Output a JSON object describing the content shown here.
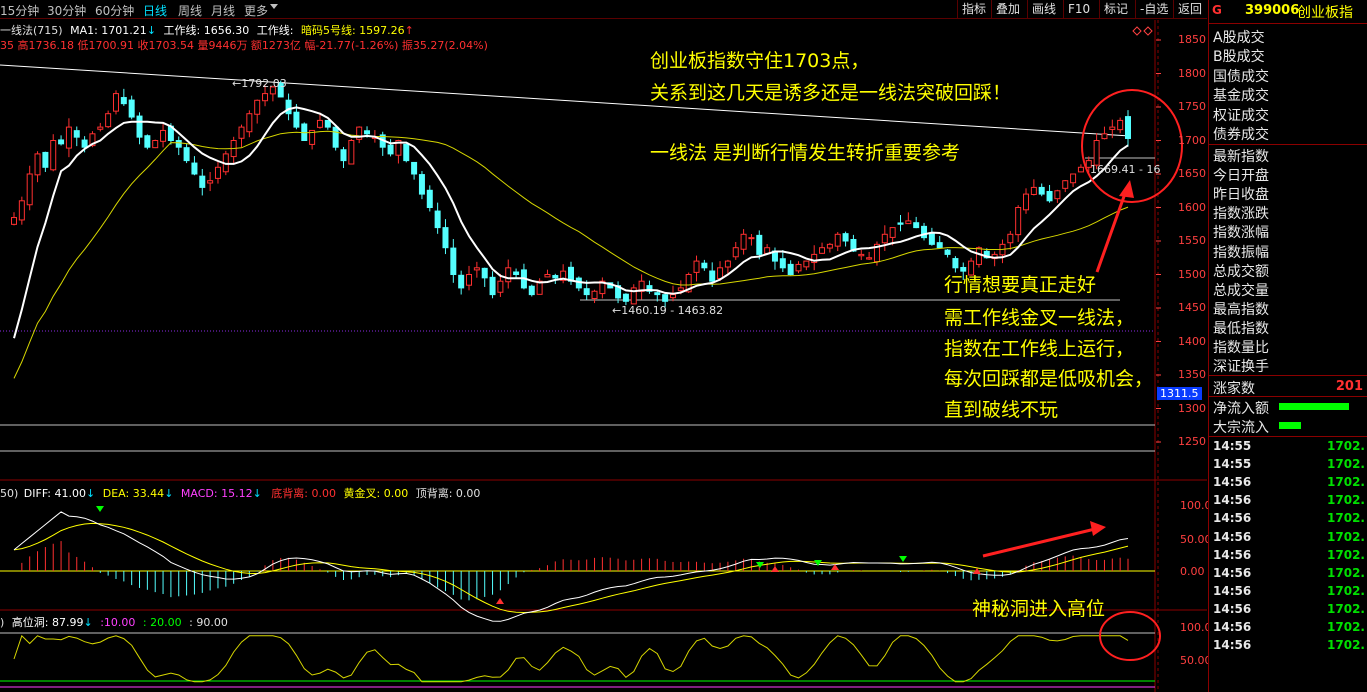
{
  "toolbar": {
    "periods": [
      "15分钟",
      "30分钟",
      "60分钟",
      "日线",
      "周线",
      "月线",
      "更多"
    ],
    "active_period": "日线",
    "buttons": [
      "指标",
      "叠加",
      "画线",
      "F10",
      "标记",
      "-自选",
      "返回"
    ]
  },
  "main_header": {
    "indicator": "一线法(715)",
    "ma1_label": "MA1: 1701.21",
    "work1_label": "工作线: 1656.30",
    "work2_label": "工作线:",
    "code5_label": "暗码5号线: 1597.26",
    "ohlc_text": "35 高1736.18 低1700.91 收1703.54 量9446万 额1273亿 幅-21.77(-1.26%) 振35.27(2.04%)"
  },
  "price_axis": [
    "1850",
    "1800",
    "1750",
    "1700",
    "1650",
    "1600",
    "1550",
    "1500",
    "1450",
    "1400",
    "1350",
    "1300",
    "1250"
  ],
  "current_price_tag": "1311.5",
  "chart_labels": {
    "high_mark": "1792.03",
    "low_mark": "1460.19 - 1463.82",
    "right_mark": "1669.41 - 16"
  },
  "macd_header": {
    "prefix": "50)",
    "diff": "DIFF: 41.00",
    "dea": "DEA: 33.44",
    "macd": "MACD: 15.12",
    "bottom_div": "底背离: 0.00",
    "golden": "黄金叉: 0.00",
    "top_div": "顶背离: 0.00"
  },
  "macd_axis": [
    "100.0",
    "50.00",
    "0.00"
  ],
  "osc_header": {
    "name": "高位洞: 87.99",
    "v1": ":10.00",
    "v2": ": 20.00",
    "v3": ": 90.00"
  },
  "osc_axis": [
    "100.0",
    "50.00"
  ],
  "annotations": {
    "a1": "创业板指数守住1703点，",
    "a2": "关系到这几天是诱多还是一线法突破回踩！",
    "a3": "一线法  是判断行情发生转折重要参考",
    "a4": "行情想要真正走好",
    "a5": "需工作线金叉一线法，",
    "a6": "指数在工作线上运行，",
    "a7": "每次回踩都是低吸机会，",
    "a8": "直到破线不玩",
    "a9": "神秘洞进入高位"
  },
  "right_panel": {
    "marker": "G",
    "code": "399006",
    "name": "创业板指",
    "volume_items": [
      "A股成交",
      "B股成交",
      "国债成交",
      "基金成交",
      "权证成交",
      "债券成交"
    ],
    "stat_items": [
      "最新指数",
      "今日开盘",
      "昨日收盘",
      "指数涨跌",
      "指数涨幅",
      "指数振幅",
      "总成交额",
      "总成交量",
      "最高指数",
      "最低指数",
      "指数量比",
      "深证换手"
    ],
    "rise_label": "涨家数",
    "rise_value": "201",
    "net_inflow": "净流入额",
    "big_inflow": "大宗流入",
    "ticks": [
      {
        "time": "14:55",
        "price": "1702."
      },
      {
        "time": "14:55",
        "price": "1702."
      },
      {
        "time": "14:56",
        "price": "1702."
      },
      {
        "time": "14:56",
        "price": "1702."
      },
      {
        "time": "14:56",
        "price": "1702."
      },
      {
        "time": "14:56",
        "price": "1702."
      },
      {
        "time": "14:56",
        "price": "1702."
      },
      {
        "time": "14:56",
        "price": "1702."
      },
      {
        "time": "14:56",
        "price": "1702."
      },
      {
        "time": "14:56",
        "price": "1702."
      },
      {
        "time": "14:56",
        "price": "1702."
      },
      {
        "time": "14:56",
        "price": "1702."
      }
    ]
  },
  "colors": {
    "up": "#ff3030",
    "down": "#54ffff",
    "ma_white": "#ffffff",
    "ma_yellow": "#d6d600",
    "annotation": "#ffff00",
    "grid": "#7a0000"
  },
  "chart_data": {
    "type": "candlestick",
    "ylim": [
      1230,
      1870
    ],
    "closes": [
      1585,
      1610,
      1650,
      1680,
      1660,
      1700,
      1695,
      1720,
      1705,
      1690,
      1710,
      1720,
      1740,
      1770,
      1755,
      1735,
      1705,
      1690,
      1700,
      1715,
      1700,
      1690,
      1670,
      1650,
      1630,
      1640,
      1660,
      1680,
      1700,
      1720,
      1740,
      1760,
      1770,
      1780,
      1765,
      1740,
      1720,
      1700,
      1715,
      1730,
      1720,
      1690,
      1670,
      1700,
      1720,
      1710,
      1705,
      1690,
      1680,
      1700,
      1670,
      1650,
      1620,
      1600,
      1570,
      1540,
      1500,
      1480,
      1500,
      1510,
      1495,
      1470,
      1490,
      1510,
      1500,
      1480,
      1470,
      1490,
      1500,
      1495,
      1505,
      1490,
      1480,
      1470,
      1475,
      1490,
      1480,
      1465,
      1460,
      1480,
      1490,
      1475,
      1470,
      1460,
      1470,
      1480,
      1500,
      1520,
      1510,
      1490,
      1510,
      1520,
      1540,
      1560,
      1555,
      1530,
      1540,
      1520,
      1510,
      1500,
      1515,
      1520,
      1530,
      1540,
      1545,
      1560,
      1550,
      1535,
      1530,
      1525,
      1545,
      1560,
      1570,
      1575,
      1580,
      1570,
      1555,
      1545,
      1540,
      1530,
      1510,
      1505,
      1520,
      1540,
      1525,
      1530,
      1545,
      1560,
      1600,
      1620,
      1630,
      1620,
      1610,
      1625,
      1640,
      1650,
      1660,
      1670,
      1700,
      1710,
      1720,
      1730,
      1703
    ]
  }
}
